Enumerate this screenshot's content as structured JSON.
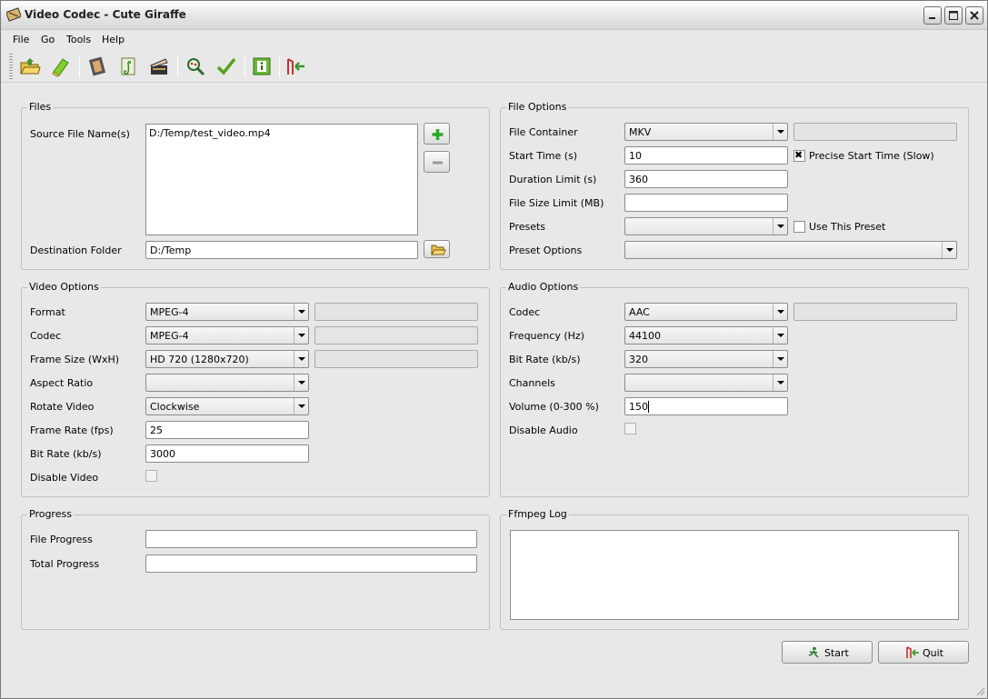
{
  "window": {
    "title": "Video Codec - Cute Giraffe"
  },
  "menu": [
    "File",
    "Go",
    "Tools",
    "Help"
  ],
  "toolbar_icons": [
    "open-folder-icon",
    "eraser-icon",
    "film-icon",
    "music-icon",
    "clapperboard-icon",
    "search-icon",
    "check-icon",
    "info-icon",
    "exit-icon"
  ],
  "files": {
    "title": "Files",
    "source_label": "Source File Name(s)",
    "source_files": [
      "D:/Temp/test_video.mp4"
    ],
    "destination_label": "Destination Folder",
    "destination_value": "D:/Temp"
  },
  "file_options": {
    "title": "File Options",
    "container_label": "File Container",
    "container_value": "MKV",
    "start_time_label": "Start Time (s)",
    "start_time_value": "10",
    "precise_label": "Precise Start Time (Slow)",
    "precise_checked": true,
    "duration_label": "Duration Limit (s)",
    "duration_value": "360",
    "size_limit_label": "File Size Limit (MB)",
    "size_limit_value": "",
    "presets_label": "Presets",
    "presets_value": "",
    "use_preset_label": "Use This Preset",
    "preset_options_label": "Preset Options",
    "preset_options_value": ""
  },
  "video_options": {
    "title": "Video Options",
    "format_label": "Format",
    "format_value": "MPEG-4",
    "codec_label": "Codec",
    "codec_value": "MPEG-4",
    "frame_size_label": "Frame Size (WxH)",
    "frame_size_value": "HD 720 (1280x720)",
    "aspect_label": "Aspect Ratio",
    "aspect_value": "",
    "rotate_label": "Rotate Video",
    "rotate_value": "Clockwise",
    "frame_rate_label": "Frame Rate (fps)",
    "frame_rate_value": "25",
    "bit_rate_label": "Bit Rate (kb/s)",
    "bit_rate_value": "3000",
    "disable_label": "Disable Video"
  },
  "audio_options": {
    "title": "Audio Options",
    "codec_label": "Codec",
    "codec_value": "AAC",
    "frequency_label": "Frequency (Hz)",
    "frequency_value": "44100",
    "bit_rate_label": "Bit Rate (kb/s)",
    "bit_rate_value": "320",
    "channels_label": "Channels",
    "channels_value": "",
    "volume_label": "Volume (0-300 %)",
    "volume_value": "150",
    "disable_label": "Disable Audio"
  },
  "progress": {
    "title": "Progress",
    "file_label": "File Progress",
    "total_label": "Total Progress"
  },
  "log": {
    "title": "Ffmpeg Log"
  },
  "buttons": {
    "start": "Start",
    "quit": "Quit"
  }
}
